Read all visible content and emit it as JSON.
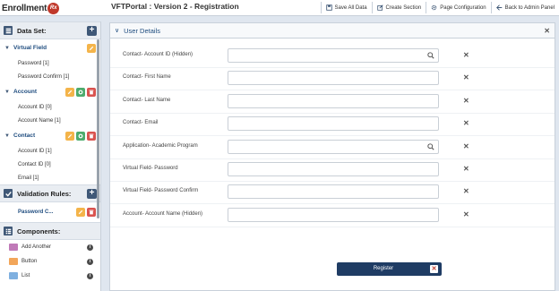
{
  "header": {
    "logo_text": "Enrollment",
    "logo_badge": "Rx",
    "title": "VFTPortal : Version 2 - Registration",
    "toolbar": [
      {
        "label": "Save All Data",
        "icon": "save-icon"
      },
      {
        "label": "Create Section",
        "icon": "edit-icon"
      },
      {
        "label": "Page Configuration",
        "icon": "gear-icon"
      },
      {
        "label": "Back to Admin Panel",
        "icon": "back-icon"
      }
    ]
  },
  "sidebar": {
    "dataset": {
      "title": "Data Set:",
      "groups": [
        {
          "name": "Virtual Field",
          "fields": [
            "Password [1]",
            "Password Confirm [1]"
          ]
        },
        {
          "name": "Account",
          "fields": [
            "Account ID [0]",
            "Account Name [1]"
          ]
        },
        {
          "name": "Contact",
          "fields": [
            "Account ID [1]",
            "Contact ID [0]",
            "Email [1]"
          ]
        }
      ]
    },
    "validation": {
      "title": "Validation Rules:",
      "items": [
        "Password C..."
      ]
    },
    "components": {
      "title": "Components:",
      "items": [
        {
          "label": "Add Another",
          "color": "#c07ab8"
        },
        {
          "label": "Button",
          "color": "#f2a65a"
        },
        {
          "label": "List",
          "color": "#7fb0e0"
        }
      ]
    }
  },
  "panel": {
    "title": "User Details",
    "fields": [
      {
        "label": "Contact- Account ID (Hidden)",
        "lookup": true
      },
      {
        "label": "Contact- First Name",
        "lookup": false
      },
      {
        "label": "Contact- Last Name",
        "lookup": false
      },
      {
        "label": "Contact- Email",
        "lookup": false
      },
      {
        "label": "Application- Academic Program",
        "lookup": true
      },
      {
        "label": "Virtual Field- Password",
        "lookup": false
      },
      {
        "label": "Virtual Field- Password Confirm",
        "lookup": false
      },
      {
        "label": "Account- Account Name (Hidden)",
        "lookup": false
      }
    ],
    "register_label": "Register"
  },
  "colors": {
    "accent": "#1f3c64",
    "link": "#1d4b7e",
    "edit": "#f4b44a",
    "view": "#4dab6d",
    "delete": "#d9534f"
  }
}
